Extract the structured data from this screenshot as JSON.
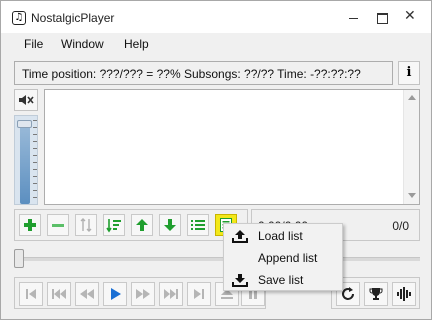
{
  "window": {
    "title": "NostalgicPlayer",
    "app_icon": "♫"
  },
  "menu": {
    "items": [
      "File",
      "Window",
      "Help"
    ]
  },
  "info": {
    "text": "Time position: ???/??? = ??% Subsongs: ??/?? Time: -??:??:??",
    "button_glyph": "i"
  },
  "mute": {
    "glyph": "◀×"
  },
  "status": {
    "time": "0:00/0:00",
    "count": "0/0"
  },
  "context_menu": {
    "items": [
      {
        "label": "Load list",
        "icon": "upload-icon"
      },
      {
        "label": "Append list",
        "icon": "append-icon"
      },
      {
        "label": "Save list",
        "icon": "download-icon"
      }
    ]
  },
  "colors": {
    "green": "#1f9e2e",
    "blue": "#1a6fd4",
    "highlight": "#f3e81a"
  }
}
